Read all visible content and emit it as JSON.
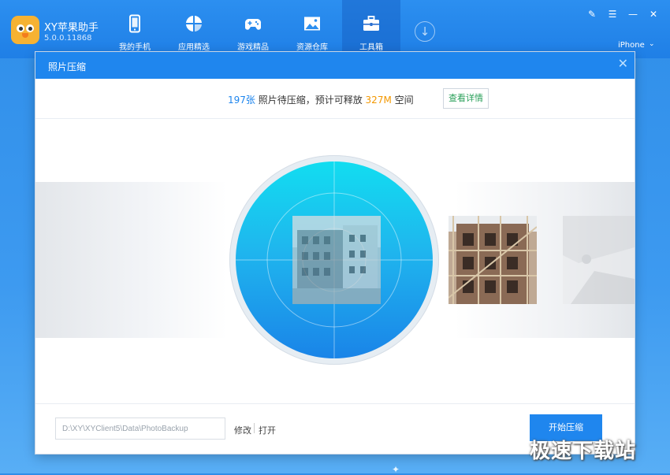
{
  "app": {
    "name": "XY苹果助手",
    "version": "5.0.0.11868",
    "device": "iPhone"
  },
  "nav": {
    "items": [
      {
        "label": "我的手机",
        "icon": "phone-icon"
      },
      {
        "label": "应用精选",
        "icon": "apps-icon"
      },
      {
        "label": "游戏精品",
        "icon": "gamepad-icon"
      },
      {
        "label": "资源仓库",
        "icon": "picture-icon"
      },
      {
        "label": "工具箱",
        "icon": "toolbox-icon"
      }
    ],
    "active": "工具箱"
  },
  "dialog": {
    "title": "照片压缩",
    "summary": {
      "count": "197张",
      "middle": " 照片待压缩，预计可释放 ",
      "size": "327M",
      "tail": " 空间"
    },
    "detail_button": "查看详情",
    "path": "D:\\XY\\XYClient5\\Data\\PhotoBackup",
    "modify_link": "修改",
    "open_link": "打开",
    "start_button": "开始压缩"
  },
  "watermark": "极速下载站",
  "colors": {
    "accent": "#1f86ee",
    "count": "#1f86ee",
    "size": "#f39800",
    "detail_text": "#2aa05a"
  }
}
